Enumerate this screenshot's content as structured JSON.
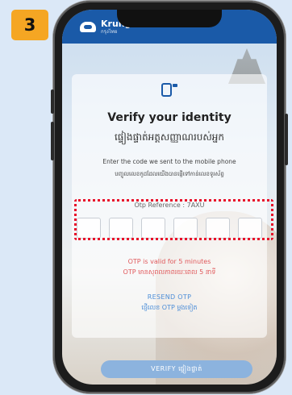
{
  "step": "3",
  "header": {
    "brand_name": "Krungthai",
    "brand_sub": "กรุงไทย"
  },
  "card": {
    "title": "Verify your identity",
    "title_km": "ផ្ទៀងផ្ទាត់អត្តសញ្ញាណរបស់អ្នក",
    "hint": "Enter the code we sent to the mobile phone",
    "hint_km": "បញ្ចូលលេខកូដដែលយើងបានផ្ញើទៅកាន់លេខទូរស័ព្ទ",
    "otp_reference": "Otp Reference : 7AXU",
    "otp_digits": [
      "",
      "",
      "",
      "",
      "",
      ""
    ],
    "valid_text": "OTP is valid for 5 minutes",
    "valid_text_km": "OTP មានសុពលភាពរយៈពេល 5 នាទី",
    "resend_label": "RESEND OTP",
    "resend_label_km": "ផ្ញើលេខ OTP ម្តងទៀត",
    "verify_label": "VERIFY ផ្ទៀងផ្ទាត់"
  },
  "colors": {
    "accent": "#1a5aa8",
    "badge": "#f5a623",
    "highlight": "#e8102a",
    "warning": "#e0585b",
    "link": "#4d8ed8"
  }
}
